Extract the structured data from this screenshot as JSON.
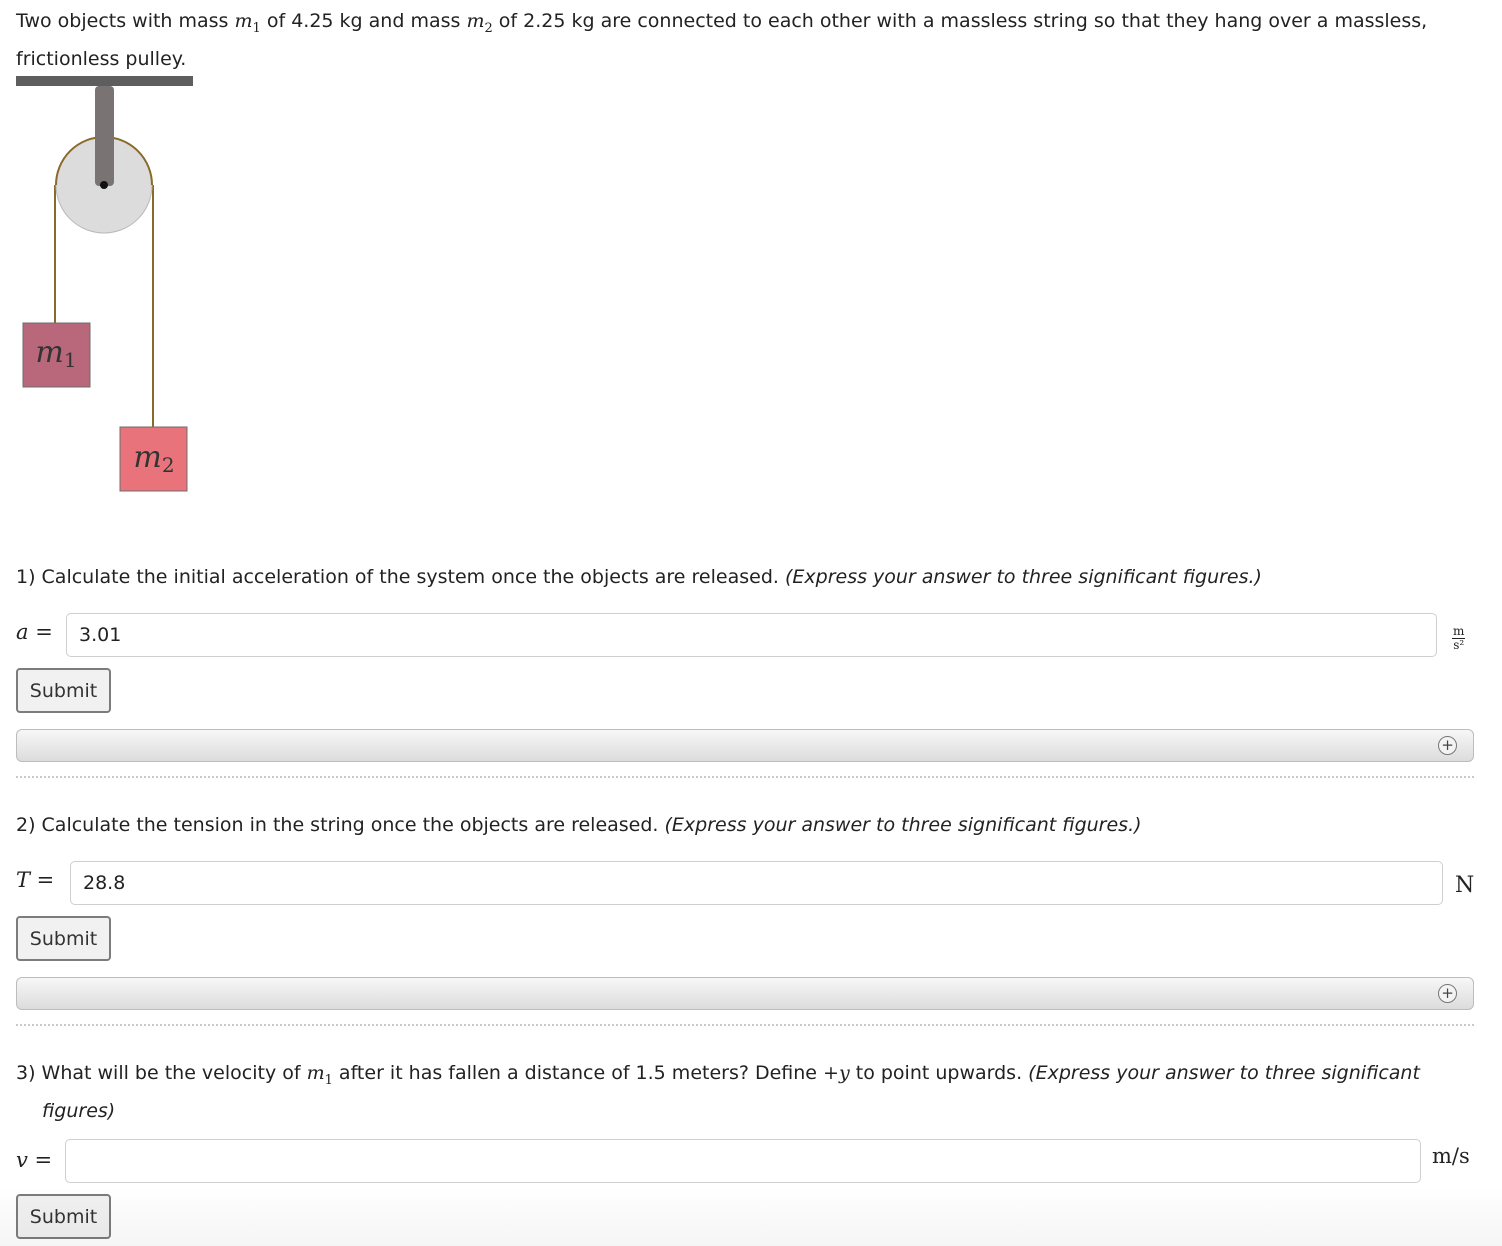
{
  "problem": {
    "intro_a": "Two objects with mass ",
    "m1_sym": "m",
    "m1_sub": "1",
    "intro_b": " of 4.25 kg and mass ",
    "m2_sym": "m",
    "m2_sub": "2",
    "intro_c": " of 2.25 kg are connected to each other with a massless string so that they hang over a massless, frictionless pulley."
  },
  "figure": {
    "m1_sym": "m",
    "m1_sub": "1",
    "m2_sym": "m",
    "m2_sub": "2",
    "colors": {
      "ceiling": "#5e5e5e",
      "rod": "#7a7373",
      "pulley_fill": "#dcdcdc",
      "pulley_rim": "#8a6a2a",
      "string": "#8a6a2a",
      "m1_block": "#b8687a",
      "m2_block": "#e8737a"
    }
  },
  "questions": [
    {
      "number_text": "1) Calculate the initial acceleration of the system once the objects are released.",
      "hint": "(Express your answer to three significant figures.)",
      "variable": "a =",
      "value": "3.01",
      "unit_num": "m",
      "unit_den": "s²",
      "submit_label": "Submit",
      "feedback_icon": "plus-icon"
    },
    {
      "number_text": "2) Calculate the tension in the string once the objects are released.",
      "hint": "(Express your answer to three significant figures.)",
      "variable": "T =",
      "value": "28.8",
      "unit": "N",
      "submit_label": "Submit",
      "feedback_icon": "plus-icon"
    },
    {
      "text_a": "3) What will be the velocity of ",
      "m1_sym": "m",
      "m1_sub": "1",
      "text_b": " after it has fallen a distance of 1.5 meters? Define ",
      "dir": "+y",
      "text_c": " to point upwards.",
      "hint": "(Express your answer to three significant figures)",
      "variable": "v =",
      "value": "",
      "unit": "m/s",
      "submit_label": "Submit"
    }
  ]
}
